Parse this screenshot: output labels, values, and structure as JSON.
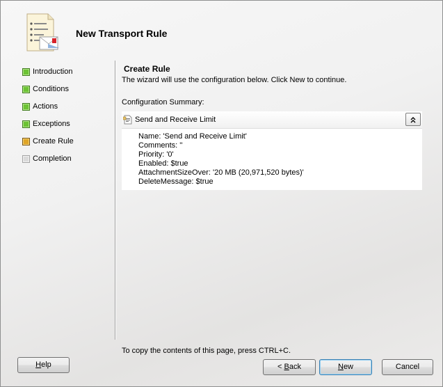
{
  "wizard": {
    "title": "New Transport Rule",
    "icon": "transport-rule-icon"
  },
  "nav": {
    "items": [
      {
        "label": "Introduction",
        "status": "completed"
      },
      {
        "label": "Conditions",
        "status": "completed"
      },
      {
        "label": "Actions",
        "status": "completed"
      },
      {
        "label": "Exceptions",
        "status": "completed"
      },
      {
        "label": "Create Rule",
        "status": "current"
      },
      {
        "label": "Completion",
        "status": "pending"
      }
    ]
  },
  "page": {
    "title": "Create Rule",
    "description": "The wizard will use the configuration below.  Click New to continue.",
    "summary_label": "Configuration Summary:"
  },
  "summary": {
    "name": "Send and Receive Limit",
    "lines": [
      "Name: 'Send and Receive Limit'",
      "Comments: ''",
      "Priority: '0'",
      "Enabled: $true",
      "AttachmentSizeOver: '20 MB (20,971,520 bytes)'",
      "DeleteMessage: $true"
    ]
  },
  "footer": {
    "note": "To copy the contents of this page, press CTRL+C."
  },
  "buttons": {
    "help": {
      "before": "",
      "mnemonic": "H",
      "after": "elp"
    },
    "back": {
      "before": "< ",
      "mnemonic": "B",
      "after": "ack"
    },
    "new": {
      "before": "",
      "mnemonic": "N",
      "after": "ew"
    },
    "cancel": {
      "before": "Cancel",
      "mnemonic": "",
      "after": ""
    }
  },
  "colors": {
    "completed": "#6cc334",
    "current": "#e0a526",
    "pending": "#dadada",
    "default_button_border": "#3c7fb1"
  }
}
